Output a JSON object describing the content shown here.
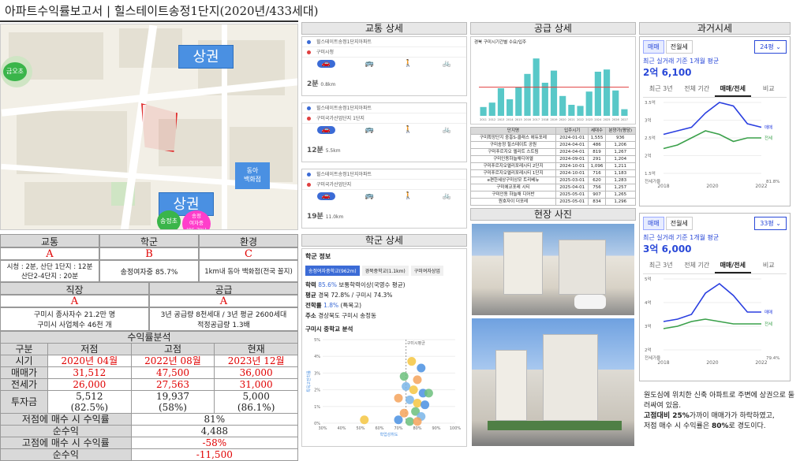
{
  "title": "아파트수익률보고서 | 힐스테이트송정1단지(2020년/433세대)",
  "map": {
    "label_top": "상권",
    "label_mid": "상권",
    "label_left": "금오초",
    "label_dept": "동아\n백화점",
    "label_school1": "송정초",
    "label_school2": "송정\n여자중\n(85.7%)"
  },
  "grades": {
    "headers": [
      "교통",
      "학군",
      "환경"
    ],
    "values": [
      "A",
      "B",
      "C"
    ],
    "details": [
      "시청 : 2분, 산단 1단지 : 12분\n산단2-4단지 : 20분",
      "송정여자중 85.7%",
      "1km내 동아 백화점(전국 꼴지)"
    ],
    "headers2": [
      "직장",
      "공급"
    ],
    "values2": [
      "A",
      "A"
    ],
    "details2": [
      "구미시 종사자수 21.2만 명\n구미시 사업체수 46천 개",
      "3년 공급량 8천세대 / 3년 평균 2600세대\n적정공급량 1.3배"
    ]
  },
  "returns": {
    "title": "수익률분석",
    "cols": [
      "구분",
      "저점",
      "고점",
      "현재"
    ],
    "rows": [
      [
        "시기",
        "2020년 04월",
        "2022년 08월",
        "2023년 12월"
      ],
      [
        "매매가",
        "31,512",
        "47,500",
        "36,000"
      ],
      [
        "전세가",
        "26,000",
        "27,563",
        "31,000"
      ]
    ],
    "invest_label": "투자금",
    "invest": [
      [
        "5,512",
        "(82.5%)"
      ],
      [
        "19,937",
        "(58%)"
      ],
      [
        "5,000",
        "(86.1%)"
      ]
    ],
    "summary": [
      [
        "저점에 매수 시 수익률",
        "81%"
      ],
      [
        "순수익",
        "4,488"
      ],
      [
        "고점에 매수 시 수익률",
        "-58%"
      ],
      [
        "순수익",
        "-11,500"
      ]
    ]
  },
  "traffic": {
    "title": "교통 상세",
    "cards": [
      {
        "from": "힐스테이트송정1단지아파트",
        "to": "구미시청",
        "time": "2분",
        "dist": "0.8km"
      },
      {
        "from": "힐스테이트송정1단지아파트",
        "to": "구미국가산업단지 1단지",
        "time": "12분",
        "dist": "5.5km"
      },
      {
        "from": "힐스테이트송정1단지아파트",
        "to": "구미국가산업단지",
        "time": "19분",
        "dist": "11.0km"
      }
    ]
  },
  "school": {
    "title": "학군 상세",
    "info_title": "학군 정보",
    "tabs": [
      "송정여자중학교(962m)",
      "경북중학교(1.1km)",
      "구미여자상업"
    ],
    "rate_label": "학력",
    "rate": "85.6%",
    "rate_text": "보통학력이상(국영수 평균)",
    "avg_label": "평균",
    "avg_text": "경북 72.8% / 구미시 74.3%",
    "move_label": "전학률",
    "move": "1.8%",
    "move_text": "(특목고)",
    "addr_label": "주소",
    "addr": "경상북도 구미시 송정동",
    "chart_title": "구미시 중학교 분석",
    "chart_ylabel": "특목고진학률",
    "chart_xlabel": "학업성취도",
    "chart_side_label": "구미시평균"
  },
  "chart_data": [
    {
      "type": "scatter",
      "title": "구미시 중학교 분석",
      "xlabel": "학업성취도",
      "ylabel": "특목고진학률",
      "x_ticks": [
        "30%",
        "40%",
        "50%",
        "60%",
        "70%",
        "80%",
        "90%",
        "100%"
      ],
      "y_ticks": [
        "0%",
        "1%",
        "2%",
        "3%",
        "4%",
        "5%"
      ],
      "xlim": [
        0.3,
        1.0
      ],
      "ylim": [
        0,
        0.05
      ],
      "points": [
        {
          "x": 0.77,
          "y": 0.037
        },
        {
          "x": 0.82,
          "y": 0.033
        },
        {
          "x": 0.73,
          "y": 0.028
        },
        {
          "x": 0.8,
          "y": 0.026
        },
        {
          "x": 0.74,
          "y": 0.022
        },
        {
          "x": 0.78,
          "y": 0.02
        },
        {
          "x": 0.83,
          "y": 0.018
        },
        {
          "x": 0.86,
          "y": 0.018
        },
        {
          "x": 0.7,
          "y": 0.015
        },
        {
          "x": 0.76,
          "y": 0.014
        },
        {
          "x": 0.8,
          "y": 0.012
        },
        {
          "x": 0.84,
          "y": 0.011
        },
        {
          "x": 0.79,
          "y": 0.007
        },
        {
          "x": 0.73,
          "y": 0.006
        },
        {
          "x": 0.82,
          "y": 0.004
        },
        {
          "x": 0.52,
          "y": 0.002
        },
        {
          "x": 0.7,
          "y": 0.002
        },
        {
          "x": 0.76,
          "y": 0.001
        },
        {
          "x": 0.8,
          "y": 0.001
        }
      ]
    },
    {
      "type": "bar",
      "title": "경북 구미시기간별 수요/입주",
      "categories": [
        "2011",
        "2012",
        "2013",
        "2014",
        "2015",
        "2016",
        "2017",
        "2018",
        "2019",
        "2020",
        "2021",
        "2022",
        "2023",
        "2024",
        "2025",
        "2026",
        "2027"
      ],
      "values": [
        800,
        1200,
        2500,
        1500,
        2600,
        3800,
        5200,
        3000,
        4100,
        1800,
        1000,
        900,
        2200,
        4000,
        4200,
        2300,
        600
      ],
      "line_value": 2600
    },
    {
      "type": "line",
      "title": "24평",
      "y_ticks": [
        "3.5억",
        "3억",
        "2.5억",
        "2억",
        "1.5억"
      ],
      "x_ticks": [
        "2018",
        "2020",
        "2022"
      ],
      "series": [
        {
          "name": "매매",
          "values": [
            2.6,
            2.7,
            2.8,
            3.2,
            3.5,
            3.4,
            2.9,
            2.8
          ]
        },
        {
          "name": "전세",
          "values": [
            2.2,
            2.3,
            2.5,
            2.7,
            2.6,
            2.4,
            2.5,
            2.5
          ]
        }
      ]
    },
    {
      "type": "line",
      "title": "33평",
      "y_ticks": [
        "5억",
        "4억",
        "3억",
        "2억"
      ],
      "x_ticks": [
        "2018",
        "2020",
        "2022"
      ],
      "series": [
        {
          "name": "매매",
          "values": [
            3.2,
            3.3,
            3.5,
            4.4,
            4.8,
            4.3,
            3.6,
            3.6
          ]
        },
        {
          "name": "전세",
          "values": [
            2.9,
            3.0,
            3.2,
            3.3,
            3.2,
            3.1,
            3.1,
            3.1
          ]
        }
      ]
    }
  ],
  "supply": {
    "title": "공급 상세",
    "chart_title": "경북 구미시기간별 수요/입주",
    "table_head": [
      "단지명",
      "입주시기",
      "세대수",
      "분양가(평당)"
    ],
    "table_rows": [
      [
        "구미확장단지 중흥S-클래스 에듀포레",
        "2024-01-01",
        "1,555",
        "936"
      ],
      [
        "구미송정 힐스테이트 공원",
        "2024-04-01",
        "486",
        "1,206"
      ],
      [
        "구미푸르지오 엘리트 스트림",
        "2024-04-01",
        "819",
        "1,267"
      ],
      [
        "구미인동하늘채디어엘",
        "2024-09-01",
        "291",
        "1,204"
      ],
      [
        "구미푸르지오엘리포레시티 2단지",
        "2024-10-01",
        "1,096",
        "1,211"
      ],
      [
        "구미푸르지오엘리포레시티 1단지",
        "2024-10-01",
        "716",
        "1,183"
      ],
      [
        "e편한세상구미상모 트리베뉴",
        "2025-03-01",
        "620",
        "1,283"
      ],
      [
        "구미에코포레 시티",
        "2025-04-01",
        "756",
        "1,257"
      ],
      [
        "구미인동 하늘채 디어반",
        "2025-05-01",
        "907",
        "1,265"
      ],
      [
        "원호자이 더포레",
        "2025-05-01",
        "834",
        "1,296"
      ]
    ]
  },
  "photo": {
    "title": "현장 사진"
  },
  "price": {
    "title": "과거시세",
    "panels": [
      {
        "tab1": "매매",
        "tab2": "전월세",
        "size": "24평",
        "desc": "최근 실거래 기준 1개월 평균",
        "value": "2억 6,100",
        "tabs": [
          "최근 3년",
          "전체 기간",
          "매매/전세",
          "비교"
        ],
        "legend": [
          "매매",
          "전세"
        ],
        "side_label": "전세가율",
        "side_value": "81.8%"
      },
      {
        "tab1": "매매",
        "tab2": "전월세",
        "size": "33평",
        "desc": "최근 실거래 기준 1개월 평균",
        "value": "3억 6,000",
        "tabs": [
          "최근 3년",
          "전체 기간",
          "매매/전세",
          "비교"
        ],
        "legend": [
          "매매",
          "전세"
        ],
        "side_label": "전세가율",
        "side_value": "79.4%"
      }
    ]
  },
  "comment": {
    "line1": "원도심에 위치한 신축 아파트로 주변에 상권으로 둘러싸여 있음.",
    "line2_bold1": "고점대비 25%",
    "line2_rest": "가까이 매매가가 하락하였고,",
    "line3_pre": "저점 매수 시 수익률은 ",
    "line3_bold": "80%",
    "line3_post": "로 경도이다."
  },
  "colors": {
    "accent": "#2a49d8",
    "red": "#e00000",
    "sale_line": "#2a3fe0",
    "jeonse_line": "#3aa04a",
    "bar": "#58c8c8"
  }
}
